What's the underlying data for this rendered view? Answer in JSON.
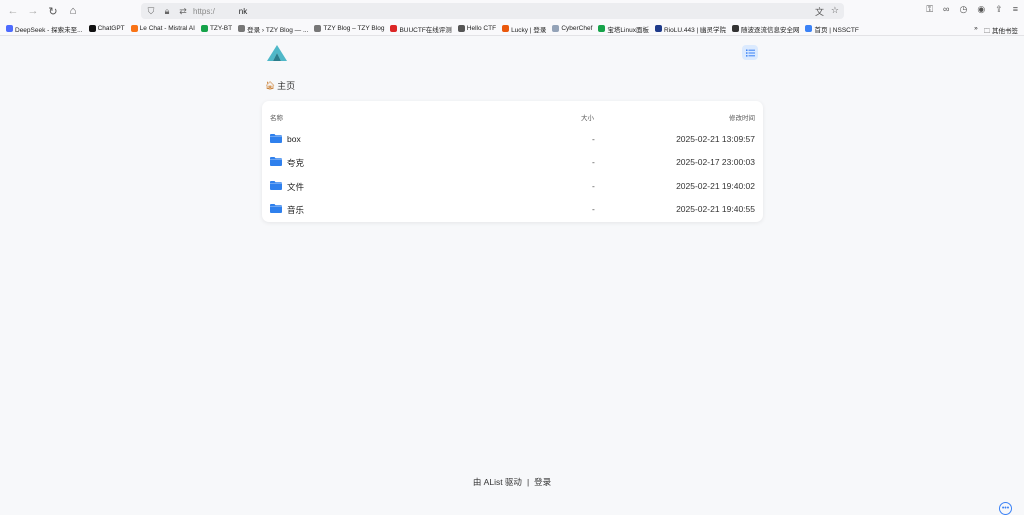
{
  "browser": {
    "url_proto": "https:/",
    "url_host": "nk",
    "bookmarks": [
      {
        "label": "DeepSeek - 探索未至...",
        "color": "#4d6bfe"
      },
      {
        "label": "ChatGPT",
        "color": "#111111"
      },
      {
        "label": "Le Chat - Mistral AI",
        "color": "#f97316"
      },
      {
        "label": "TZY-BT",
        "color": "#16a34a"
      },
      {
        "label": "登录 › TZY Blog — ...",
        "color": "#777777"
      },
      {
        "label": "TZY Blog – TZY Blog",
        "color": "#777777"
      },
      {
        "label": "BUUCTF在线评测",
        "color": "#dc2626"
      },
      {
        "label": "Hello CTF",
        "color": "#555555"
      },
      {
        "label": "Lucky | 登录",
        "color": "#ea580c"
      },
      {
        "label": "CyberChef",
        "color": "#94a3b8"
      },
      {
        "label": "宝塔Linux面板",
        "color": "#16a34a"
      },
      {
        "label": "RioLU.443 | 幽灵学院",
        "color": "#1e3a8a"
      },
      {
        "label": "随波逐流信息安全网",
        "color": "#333333"
      },
      {
        "label": "首页 | NSSCTF",
        "color": "#3b82f6"
      }
    ],
    "more_label": "其他书签"
  },
  "page": {
    "breadcrumb": "主页",
    "columns": {
      "name": "名称",
      "size": "大小",
      "modified": "修改时间"
    },
    "rows": [
      {
        "name": "box",
        "size": "-",
        "modified": "2025-02-21 13:09:57"
      },
      {
        "name": "夸克",
        "size": "-",
        "modified": "2025-02-17 23:00:03"
      },
      {
        "name": "文件",
        "size": "-",
        "modified": "2025-02-21 19:40:02"
      },
      {
        "name": "音乐",
        "size": "-",
        "modified": "2025-02-21 19:40:55"
      }
    ],
    "footer": {
      "powered": "由 AList 驱动",
      "login": "登录"
    }
  },
  "colors": {
    "accent": "#3b82f6",
    "folder": "#2f80ed",
    "logo": "#4fb8c8"
  }
}
